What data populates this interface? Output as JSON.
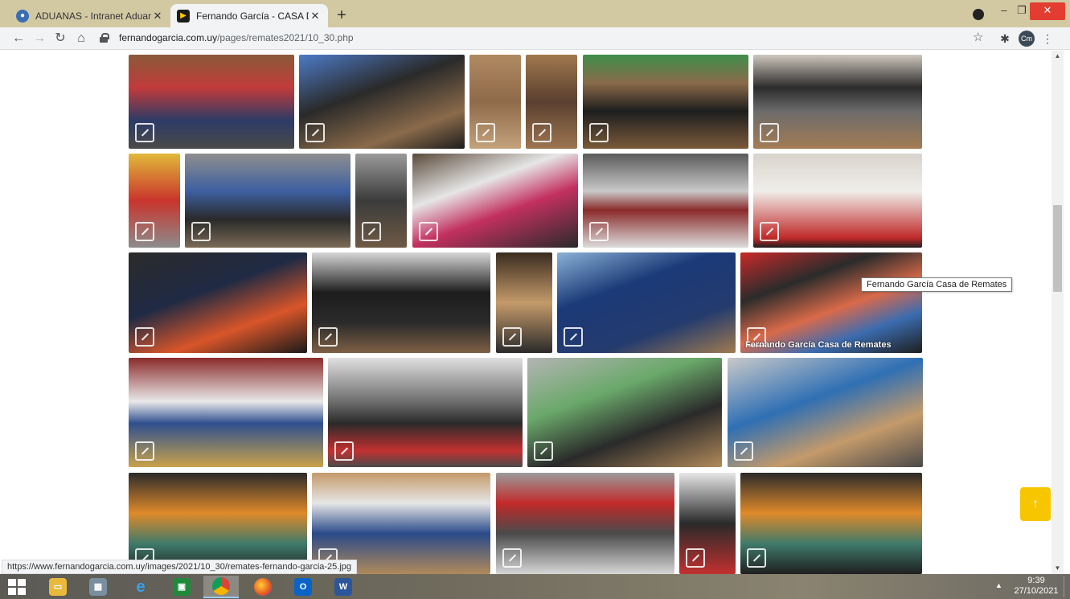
{
  "browser": {
    "tabs": [
      {
        "title": "ADUANAS - Intranet Aduanas - F",
        "favicon": "aduanas-icon",
        "active": false
      },
      {
        "title": "Fernando García - CASA DE REMA",
        "favicon": "fg-logo-icon",
        "active": true
      }
    ],
    "address": {
      "host": "fernandogarcia.com.uy",
      "path": "/pages/remates2021/10_30.php"
    },
    "profile_initials": "Cm"
  },
  "page": {
    "tooltip": "Fernando García Casa de Remates",
    "caption": "Fernando García Casa de Remates",
    "scroll_top_icon": "arrow-up-icon",
    "accent_color": "#f7c600",
    "photos": [
      {
        "subject": "sneakers"
      },
      {
        "subject": "car-speakers"
      },
      {
        "subject": "boxes-shelf"
      },
      {
        "subject": "boxes-shelf"
      },
      {
        "subject": "power-tools"
      },
      {
        "subject": "paint-buckets"
      },
      {
        "subject": "buckets"
      },
      {
        "subject": "shelf-goods"
      },
      {
        "subject": "shelf-goods"
      },
      {
        "subject": "microwave"
      },
      {
        "subject": "cables"
      },
      {
        "subject": "smart-tv-49"
      },
      {
        "subject": "xion-soundbox"
      },
      {
        "subject": "speakers"
      },
      {
        "subject": "speaker-tower"
      },
      {
        "subject": "philips-soundbar"
      },
      {
        "subject": "aiwa-tv-40"
      },
      {
        "subject": "headphones"
      },
      {
        "subject": "electronics"
      },
      {
        "subject": "backpacks"
      },
      {
        "subject": "boxed-goods"
      },
      {
        "subject": "stanley-thermos"
      },
      {
        "subject": "nvtx-boxes"
      },
      {
        "subject": "magazines"
      },
      {
        "subject": "car-radio"
      },
      {
        "subject": "stanley-thermos"
      }
    ]
  },
  "status_url": "https://www.fernandogarcia.com.uy/images/2021/10_30/remates-fernando-garcia-25.jpg",
  "taskbar": {
    "time": "9:39",
    "date": "27/10/2021",
    "apps": [
      "file-explorer-icon",
      "calculator-icon",
      "internet-explorer-icon",
      "calendar-icon",
      "chrome-icon",
      "firefox-icon",
      "outlook-icon",
      "word-icon"
    ]
  }
}
